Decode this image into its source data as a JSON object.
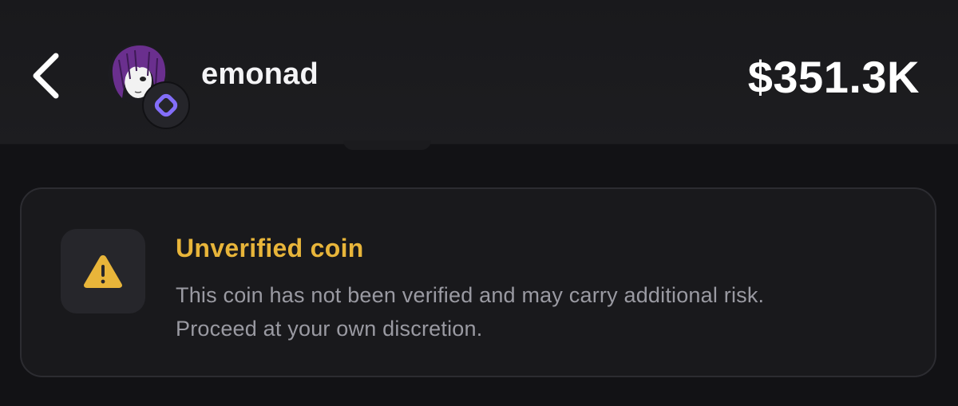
{
  "header": {
    "back_icon": "chevron-left-icon",
    "username": "emonad",
    "avatar_icon": "user-avatar",
    "chain_badge_icon": "monad-chain-icon",
    "price": "$351.3K"
  },
  "warning": {
    "icon": "warning-triangle-icon",
    "title": "Unverified coin",
    "message_line1": "This coin has not been verified and may carry additional risk.",
    "message_line2": "Proceed at your own discretion."
  },
  "colors": {
    "background": "#121215",
    "warning_accent": "#e8b53a",
    "chain_badge": "#836ef9",
    "avatar_hair": "#6a2f8e"
  }
}
